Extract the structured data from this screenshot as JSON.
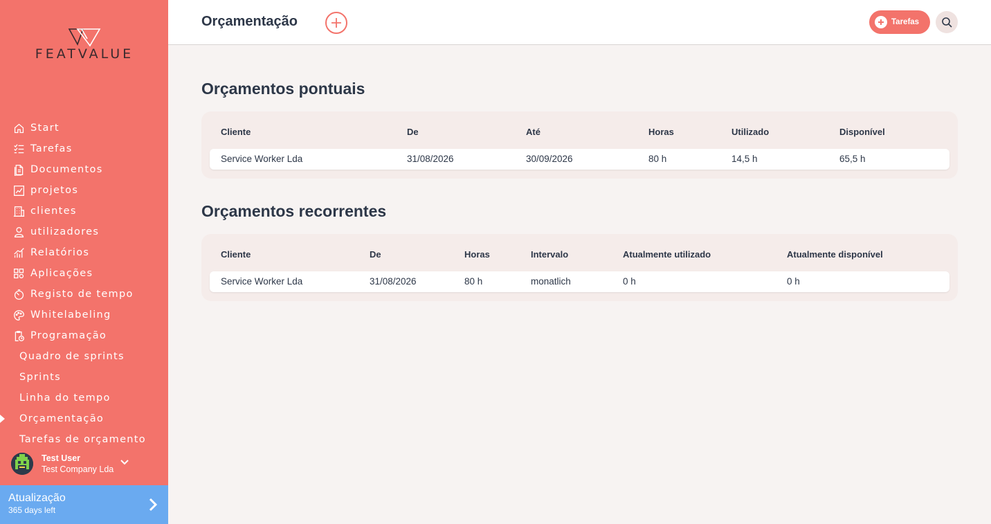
{
  "app": {
    "logo_text": "FEATVALUE"
  },
  "sidebar": {
    "items": [
      {
        "label": "Start",
        "icon": "home-icon"
      },
      {
        "label": "Tarefas",
        "icon": "checklist-icon"
      },
      {
        "label": "Documentos",
        "icon": "documents-icon"
      },
      {
        "label": "projetos",
        "icon": "chart-icon"
      },
      {
        "label": "clientes",
        "icon": "building-icon"
      },
      {
        "label": "utilizadores",
        "icon": "user-icon"
      },
      {
        "label": "Relatórios",
        "icon": "bar-chart-icon"
      },
      {
        "label": "Aplicações",
        "icon": "apps-icon"
      },
      {
        "label": "Registo de tempo",
        "icon": "timer-icon"
      },
      {
        "label": "Whitelabeling",
        "icon": "palette-icon"
      },
      {
        "label": "Programação",
        "icon": "clipboard-clock-icon"
      }
    ],
    "subitems": [
      {
        "label": "Quadro de sprints"
      },
      {
        "label": "Sprints"
      },
      {
        "label": "Linha do tempo"
      },
      {
        "label": "Orçamentação",
        "active": true
      },
      {
        "label": "Tarefas de orçamento"
      }
    ],
    "user": {
      "name": "Test User",
      "company": "Test Company Lda"
    },
    "upgrade": {
      "title": "Atualização",
      "subtitle": "365 days left"
    }
  },
  "header": {
    "title": "Orçamentação",
    "tasks_label": "Tarefas"
  },
  "budgets_one_time": {
    "title": "Orçamentos pontuais",
    "columns": [
      "Cliente",
      "De",
      "Até",
      "Horas",
      "Utilizado",
      "Disponível"
    ],
    "rows": [
      [
        "Service Worker Lda",
        "31/08/2026",
        "30/09/2026",
        "80 h",
        "14,5 h",
        "65,5 h"
      ]
    ]
  },
  "budgets_recurring": {
    "title": "Orçamentos recorrentes",
    "columns": [
      "Cliente",
      "De",
      "Horas",
      "Intervalo",
      "Atualmente utilizado",
      "Atualmente disponível"
    ],
    "rows": [
      [
        "Service Worker Lda",
        "31/08/2026",
        "80 h",
        "monatlich",
        "0 h",
        "0 h"
      ]
    ]
  },
  "colors": {
    "accent": "#f3736b",
    "upgrade": "#6aaaf0",
    "text": "#2d3748"
  }
}
